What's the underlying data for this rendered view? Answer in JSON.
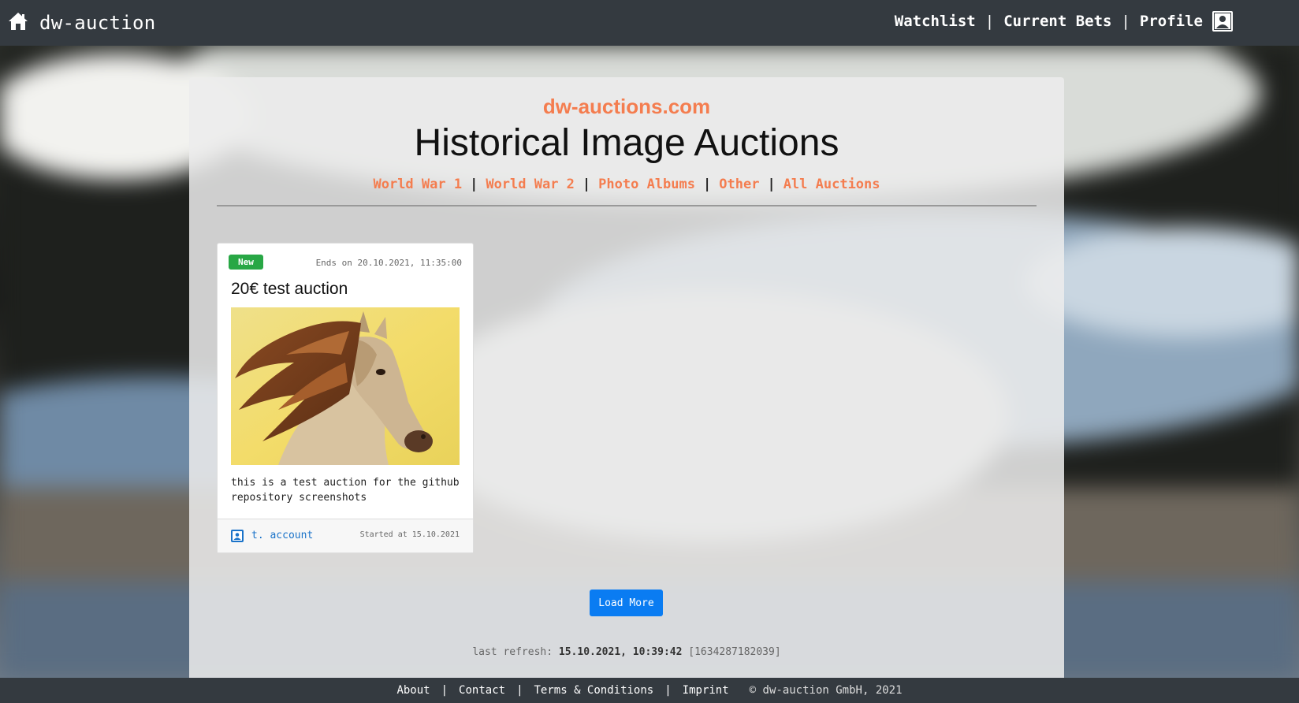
{
  "navbar": {
    "brand": "dw-auction",
    "links": [
      "Watchlist",
      "Current Bets",
      "Profile"
    ],
    "separator": "|"
  },
  "header": {
    "site_name": "dw-auctions.com",
    "title": "Historical Image Auctions",
    "categories": [
      "World War 1",
      "World War 2",
      "Photo Albums",
      "Other",
      "All Auctions"
    ],
    "separator": "|"
  },
  "auction": {
    "badge": "New",
    "ends": "Ends on 20.10.2021, 11:35:00",
    "title": "20€ test auction",
    "description": "this is a test auction for the github repository screenshots",
    "user": "t. account",
    "started": "Started at 15.10.2021"
  },
  "load_more_label": "Load More",
  "refresh": {
    "label": "last refresh:",
    "datetime": "15.10.2021, 10:39:42",
    "stamp": "[1634287182039]"
  },
  "footer": {
    "links": [
      "About",
      "Contact",
      "Terms & Conditions",
      "Imprint"
    ],
    "separator": "|",
    "copyright": "© dw-auction GmbH, 2021"
  },
  "colors": {
    "navbar_bg": "#343a40",
    "accent_orange": "#f47d4f",
    "badge_green": "#28a745",
    "button_blue": "#0a7cf2",
    "link_blue": "#1a73c9"
  },
  "icons": {
    "brand": "home-icon",
    "profile": "user-icon",
    "card_user": "user-icon"
  }
}
